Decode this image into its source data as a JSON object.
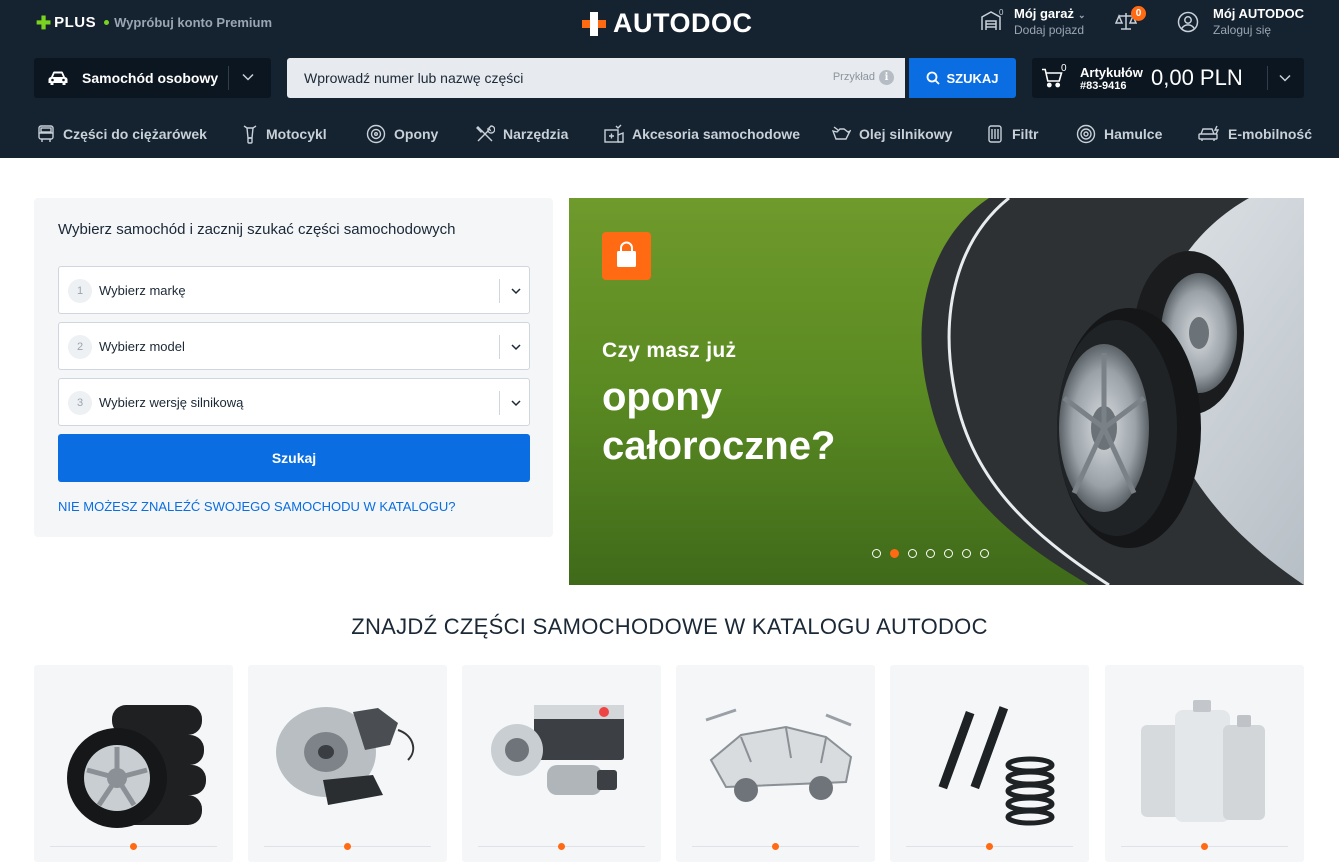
{
  "header": {
    "plus": {
      "brand": "PLUS",
      "cta": "Wypróbuj konto Premium"
    },
    "logo": "AUTODOC",
    "garage": {
      "title": "Mój garaż",
      "subtitle": "Dodaj pojazd"
    },
    "compare_count": "0",
    "account": {
      "title": "Mój AUTODOC",
      "subtitle": "Zaloguj się"
    },
    "vehicle_type": "Samochód osobowy",
    "search": {
      "placeholder": "Wprowadź numer lub nazwę części",
      "example_label": "Przykład",
      "button_label": "SZUKAJ"
    },
    "cart": {
      "count": "0",
      "label": "Artykułów",
      "number": "#83-9416",
      "total": "0,00 PLN"
    }
  },
  "nav": {
    "items": [
      {
        "label": "Części do ciężarówek",
        "icon": "truck-icon"
      },
      {
        "label": "Motocykl",
        "icon": "motorcycle-icon"
      },
      {
        "label": "Opony",
        "icon": "tire-icon"
      },
      {
        "label": "Narzędzia",
        "icon": "tools-icon"
      },
      {
        "label": "Akcesoria samochodowe",
        "icon": "car-accessories-icon"
      },
      {
        "label": "Olej silnikowy",
        "icon": "oil-can-icon"
      },
      {
        "label": "Filtr",
        "icon": "filter-icon"
      },
      {
        "label": "Hamulce",
        "icon": "brake-disc-icon"
      },
      {
        "label": "E-mobilność",
        "icon": "electric-car-icon"
      }
    ]
  },
  "selector": {
    "title": "Wybierz samochód i zacznij szukać części samochodowych",
    "fields": [
      {
        "num": "1",
        "label": "Wybierz markę"
      },
      {
        "num": "2",
        "label": "Wybierz model"
      },
      {
        "num": "3",
        "label": "Wybierz wersję silnikową"
      }
    ],
    "button_label": "Szukaj",
    "not_found_link": "NIE MOŻESZ ZNALEŹĆ SWOJEGO SAMOCHODU W KATALOGU?"
  },
  "banner": {
    "line1": "Czy masz już",
    "line2": "opony całoroczne?",
    "slides": 7,
    "active_slide": 2
  },
  "catalog": {
    "title": "ZNAJDŹ CZĘŚCI SAMOCHODOWE W KATALOGU AUTODOC",
    "cards": [
      {
        "image": "tires-image"
      },
      {
        "image": "brakes-image"
      },
      {
        "image": "electrics-image"
      },
      {
        "image": "body-parts-image"
      },
      {
        "image": "suspension-image"
      },
      {
        "image": "oil-image"
      }
    ]
  },
  "colors": {
    "header_bg": "#152230",
    "accent": "#ff6a13",
    "primary": "#0a6de1",
    "plus_green": "#7bd321"
  }
}
